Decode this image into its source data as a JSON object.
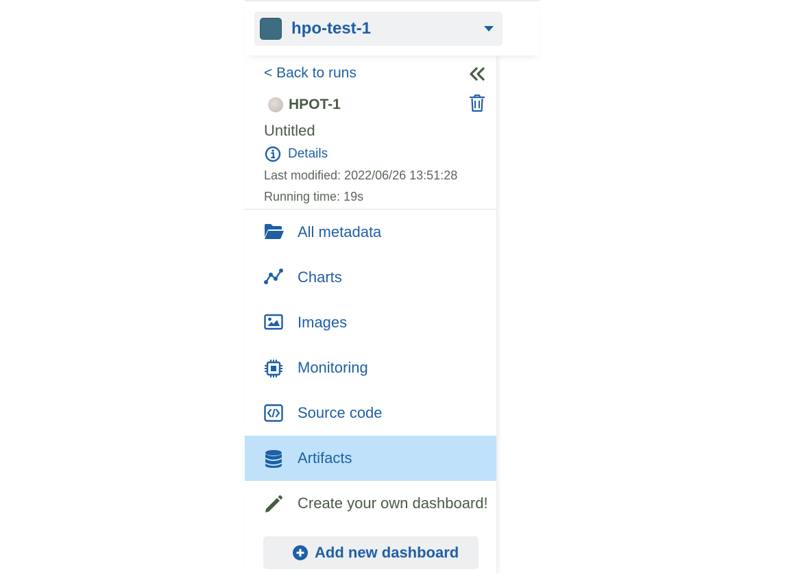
{
  "project": {
    "name": "hpo-test-1",
    "swatch_color": "#3e6d82"
  },
  "run": {
    "back_label": "< Back to runs",
    "id": "HPOT-1",
    "title": "Untitled",
    "details_label": "Details",
    "last_modified": "Last modified: 2022/06/26 13:51:28",
    "running_time": "Running time: 19s"
  },
  "nav": {
    "items": [
      {
        "label": "All metadata",
        "icon": "folder-open-icon",
        "active": false
      },
      {
        "label": "Charts",
        "icon": "line-chart-icon",
        "active": false
      },
      {
        "label": "Images",
        "icon": "image-icon",
        "active": false
      },
      {
        "label": "Monitoring",
        "icon": "cpu-chip-icon",
        "active": false
      },
      {
        "label": "Source code",
        "icon": "code-icon",
        "active": false
      },
      {
        "label": "Artifacts",
        "icon": "database-icon",
        "active": true
      },
      {
        "label": "Create your own dashboard!",
        "icon": "pencil-icon",
        "active": false
      }
    ],
    "add_dashboard_label": "Add new dashboard"
  },
  "colors": {
    "accent": "#1f5fa4",
    "active_bg": "#bfe2fa",
    "muted_text": "#4a5a47"
  }
}
